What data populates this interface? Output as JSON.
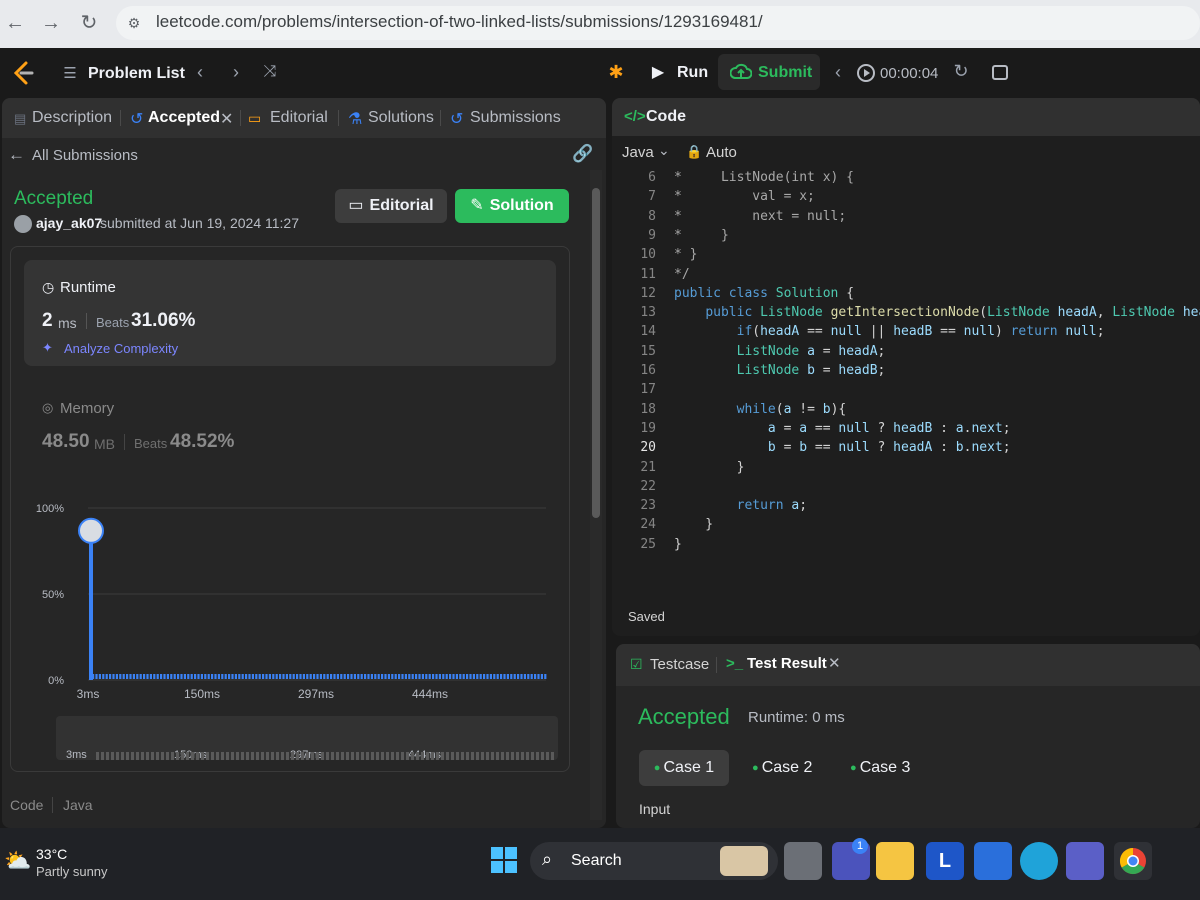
{
  "browser": {
    "url": "leetcode.com/problems/intersection-of-two-linked-lists/submissions/1293169481/",
    "back_icon": "arrow-left-icon",
    "forward_icon": "arrow-right-icon",
    "reload_icon": "reload-icon"
  },
  "navbar": {
    "problem_list": "Problem List",
    "run": "Run",
    "submit": "Submit",
    "timer": "00:00:04"
  },
  "left_tabs": {
    "description": "Description",
    "accepted": "Accepted",
    "editorial": "Editorial",
    "solutions": "Solutions",
    "submissions": "Submissions"
  },
  "submission": {
    "back_label": "All Submissions",
    "status": "Accepted",
    "user": "ajay_ak07",
    "submitted_text": "submitted at Jun 19, 2024 11:27",
    "editorial_button": "Editorial",
    "solution_button": "Solution"
  },
  "runtime": {
    "title": "Runtime",
    "value": "2",
    "unit": "ms",
    "beats_label": "Beats",
    "beats_value": "31.06%",
    "analyze": "Analyze Complexity"
  },
  "memory": {
    "title": "Memory",
    "value": "48.50",
    "unit": "MB",
    "beats_label": "Beats",
    "beats_value": "48.52%"
  },
  "chart_data": {
    "type": "bar",
    "y_tick_labels": [
      "100%",
      "50%",
      "0%"
    ],
    "x_tick_labels": [
      "3ms",
      "150ms",
      "297ms",
      "444ms"
    ],
    "highlight": {
      "x": "3ms",
      "percent": 85
    },
    "ylim": [
      0,
      100
    ]
  },
  "mini_axis": [
    "3ms",
    "150ms",
    "297ms",
    "444ms"
  ],
  "left_footer": {
    "code_label": "Code",
    "lang_label": "Java"
  },
  "code_panel": {
    "title": "Code",
    "language": "Java",
    "auto": "Auto",
    "saved": "Saved",
    "current_line": 20,
    "lines": [
      {
        "n": "6",
        "t": "*     ListNode(int x) {"
      },
      {
        "n": "7",
        "t": "*         val = x;"
      },
      {
        "n": "8",
        "t": "*         next = null;"
      },
      {
        "n": "9",
        "t": "*     }"
      },
      {
        "n": "10",
        "t": "* }"
      },
      {
        "n": "11",
        "t": "*/"
      },
      {
        "n": "12",
        "t": "public class Solution {"
      },
      {
        "n": "13",
        "t": "    public ListNode getIntersectionNode(ListNode headA, ListNode headB) {"
      },
      {
        "n": "14",
        "t": "        if(headA == null || headB == null) return null;"
      },
      {
        "n": "15",
        "t": "        ListNode a = headA;"
      },
      {
        "n": "16",
        "t": "        ListNode b = headB;"
      },
      {
        "n": "17",
        "t": ""
      },
      {
        "n": "18",
        "t": "        while(a != b){"
      },
      {
        "n": "19",
        "t": "            a = a == null ? headB : a.next;"
      },
      {
        "n": "20",
        "t": "            b = b == null ? headA : b.next;"
      },
      {
        "n": "21",
        "t": "        }"
      },
      {
        "n": "22",
        "t": ""
      },
      {
        "n": "23",
        "t": "        return a;"
      },
      {
        "n": "24",
        "t": "    }"
      },
      {
        "n": "25",
        "t": "}"
      }
    ]
  },
  "test_panel": {
    "testcase_tab": "Testcase",
    "result_tab": "Test Result",
    "status": "Accepted",
    "runtime": "Runtime: 0 ms",
    "cases": [
      "Case 1",
      "Case 2",
      "Case 3"
    ],
    "input_label": "Input"
  },
  "taskbar": {
    "temperature": "33°C",
    "weather": "Partly sunny",
    "search": "Search",
    "teams_badge": "1"
  },
  "colors": {
    "accent_green": "#2cbb5d",
    "accent_blue": "#3b82f6",
    "panel_bg": "#262626"
  }
}
